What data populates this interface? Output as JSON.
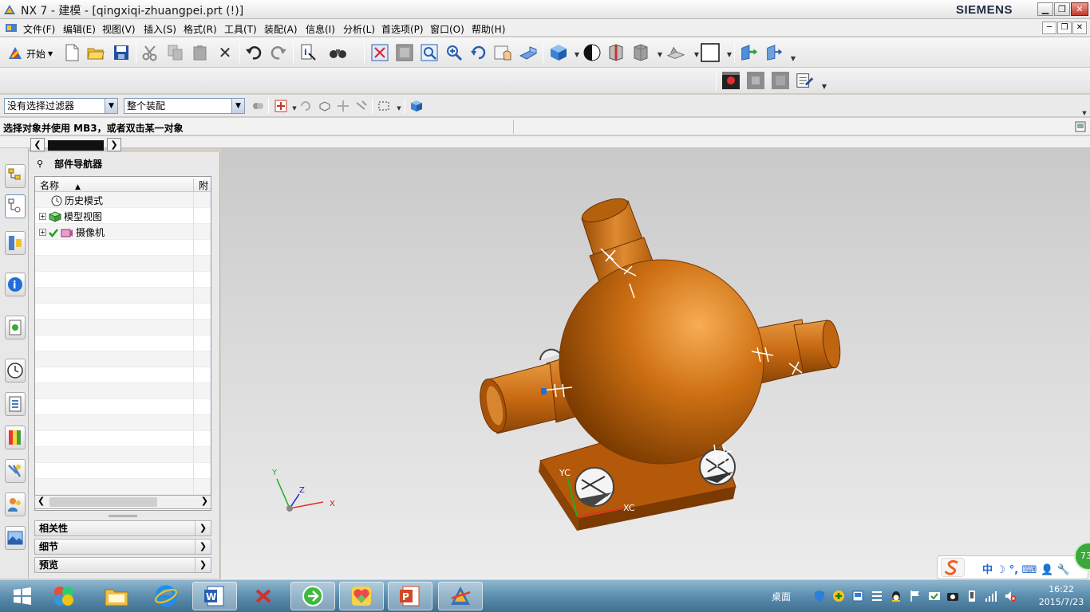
{
  "window": {
    "title": "NX 7 - 建模 - [qingxiqi-zhuangpei.prt   (!)]",
    "brand": "SIEMENS",
    "controls": {
      "minimize": "▁",
      "restore": "❐",
      "close": "✕"
    }
  },
  "menubar": {
    "items": [
      "文件(F)",
      "编辑(E)",
      "视图(V)",
      "插入(S)",
      "格式(R)",
      "工具(T)",
      "装配(A)",
      "信息(I)",
      "分析(L)",
      "首选项(P)",
      "窗口(O)",
      "帮助(H)"
    ],
    "doc_controls": {
      "minimize": "─",
      "restore": "❐",
      "close": "✕"
    }
  },
  "toolbar": {
    "start_label": "开始",
    "icons": [
      "new-icon",
      "open-icon",
      "save-icon",
      "cut-icon",
      "copy-icon",
      "paste-icon",
      "delete-icon",
      "undo-icon",
      "redo-icon",
      "info-icon",
      "binoculars-icon",
      "fit-icon",
      "zoom-window-icon",
      "zoom-icon",
      "zoom-in-icon",
      "rotate-icon",
      "pan-icon",
      "perspective-icon",
      "shaded-cube-icon",
      "render-style-icon",
      "cylinder-icon",
      "hidden-edge-icon",
      "layer-icon",
      "background-color-icon",
      "orient-view-icon",
      "work-layer-icon"
    ]
  },
  "toolbar2": {
    "icons": [
      "record-icon",
      "stop-icon",
      "pause-icon",
      "notes-icon"
    ]
  },
  "selection_bar": {
    "filter_value": "没有选择过滤器",
    "scope_value": "整个装配"
  },
  "cue_line": {
    "text": "选择对象并使用 MB3，或者双击某一对象"
  },
  "resource_bar": {
    "buttons": [
      "assembly-navigator-icon",
      "part-navigator-icon",
      "constraint-navigator-icon",
      "internet-explorer-icon",
      "history-palette-icon",
      "clock-history-icon",
      "system-materials-icon",
      "color-palette-icon",
      "process-studio-icon",
      "roles-icon",
      "system-scenes-icon"
    ]
  },
  "navigator": {
    "title": "部件导航器",
    "columns": {
      "name": "名称",
      "attached": "附"
    },
    "rows": [
      {
        "label": "历史模式",
        "icon": "clock-icon",
        "expandable": false,
        "checked": false
      },
      {
        "label": "模型视图",
        "icon": "model-view-icon",
        "expandable": true,
        "checked": false
      },
      {
        "label": "摄像机",
        "icon": "camera-icon",
        "expandable": true,
        "checked": true
      }
    ],
    "sections": [
      "相关性",
      "细节",
      "预览"
    ]
  },
  "viewport": {
    "triad": {
      "x": "X",
      "y": "Y",
      "z": "Z"
    },
    "wcs": {
      "xc": "XC",
      "yc": "YC"
    },
    "colors": {
      "body": "#c2620e",
      "highlight": "#f2a24a",
      "shadow": "#6e3300"
    }
  },
  "ime": {
    "text": "中 ☽ °, ⌨ 👤 🔧"
  },
  "badge": "73",
  "taskbar": {
    "desktop_label": "桌面",
    "time": "16:22",
    "date": "2015/7/23",
    "apps": [
      "windows-start-icon",
      "360-browser-icon",
      "file-explorer-icon",
      "internet-explorer-icon",
      "word-icon",
      "xmind-icon",
      "360-security-icon",
      "heart-app-icon",
      "powerpoint-icon",
      "nx-icon"
    ]
  }
}
